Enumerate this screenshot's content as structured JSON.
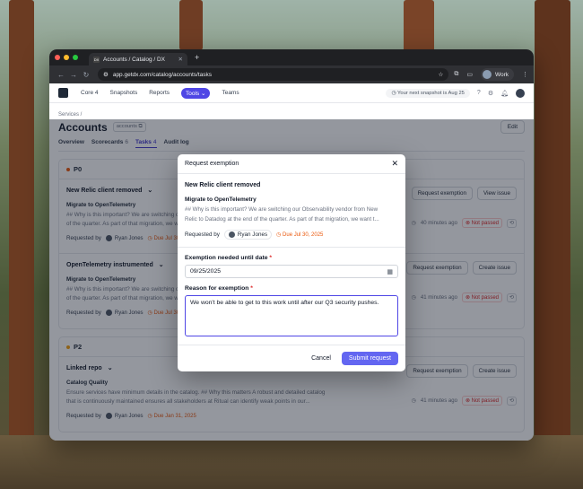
{
  "browser": {
    "tab_title": "Accounts / Catalog / DX",
    "tab_favicon": "DX",
    "url": "app.getdx.com/catalog/accounts/tasks",
    "profile_name": "Work"
  },
  "nav": {
    "items": [
      "Core 4",
      "Snapshots",
      "Reports",
      "Tools",
      "Teams"
    ],
    "active": "Tools",
    "snapshot_text": "Your next snapshot is Aug 25"
  },
  "page": {
    "breadcrumb": "Services /",
    "title": "Accounts",
    "slug": "accounts",
    "edit_label": "Edit",
    "tabs": [
      {
        "label": "Overview",
        "count": ""
      },
      {
        "label": "Scorecards",
        "count": "6"
      },
      {
        "label": "Tasks",
        "count": "4"
      },
      {
        "label": "Audit log",
        "count": ""
      }
    ],
    "active_tab": "Tasks"
  },
  "sections": [
    {
      "priority": "P0",
      "color": "#ea580c",
      "cards": [
        {
          "check": "New Relic client removed",
          "subtitle": "Migrate to OpenTelemetry",
          "desc1": "## Why is this important? We are switching our Observability vendor from New Relic to Datadog",
          "desc2": "of the quarter. As part of that migration, we want to use OpenTelemetry",
          "requested_by_label": "Requested by",
          "requester": "Ryan Jones",
          "due": "Due Jul 30, 2025",
          "btn1": "Request exemption",
          "btn2": "View issue",
          "time": "40 minutes ago",
          "status": "Not passed"
        },
        {
          "check": "OpenTelemetry instrumented",
          "subtitle": "Migrate to OpenTelemetry",
          "desc1": "## Why is this important? We are switching our Observability vendor from New Relic to Datadog",
          "desc2": "of the quarter. As part of that migration, we want to use OpenTelemetry",
          "requested_by_label": "Requested by",
          "requester": "Ryan Jones",
          "due": "Due Jul 30, 2025",
          "btn1": "Request exemption",
          "btn2": "Create issue",
          "time": "41 minutes ago",
          "status": "Not passed"
        }
      ]
    },
    {
      "priority": "P2",
      "color": "#f59e0b",
      "cards": [
        {
          "check": "Linked repo",
          "subtitle": "Catalog Quality",
          "desc1": "Ensure services have minimum details in the catalog. ## Why this matters A robust and detailed catalog",
          "desc2": "that is continuously maintained ensures all stakeholders at Ritual can identify weak points in our...",
          "requested_by_label": "Requested by",
          "requester": "Ryan Jones",
          "due": "Due Jan 31, 2025",
          "btn1": "Request exemption",
          "btn2": "Create issue",
          "time": "41 minutes ago",
          "status": "Not passed"
        }
      ]
    }
  ],
  "modal": {
    "title": "Request exemption",
    "check": "New Relic client removed",
    "initiative": "Migrate to OpenTelemetry",
    "desc1": "## Why is this important? We are switching our Observability vendor from New",
    "desc2": "Relic to Datadog at the end of the quarter. As part of that migration, we want t...",
    "requested_by_label": "Requested by",
    "requester": "Ryan Jones",
    "due": "Due Jul 30, 2025",
    "date_label": "Exemption needed until date",
    "date_value": "09/25/2025",
    "reason_label": "Reason for exemption",
    "reason_value": "We won't be able to get to this work until after our Q3 security pushes.",
    "cancel_label": "Cancel",
    "submit_label": "Submit request",
    "required_mark": "*"
  }
}
